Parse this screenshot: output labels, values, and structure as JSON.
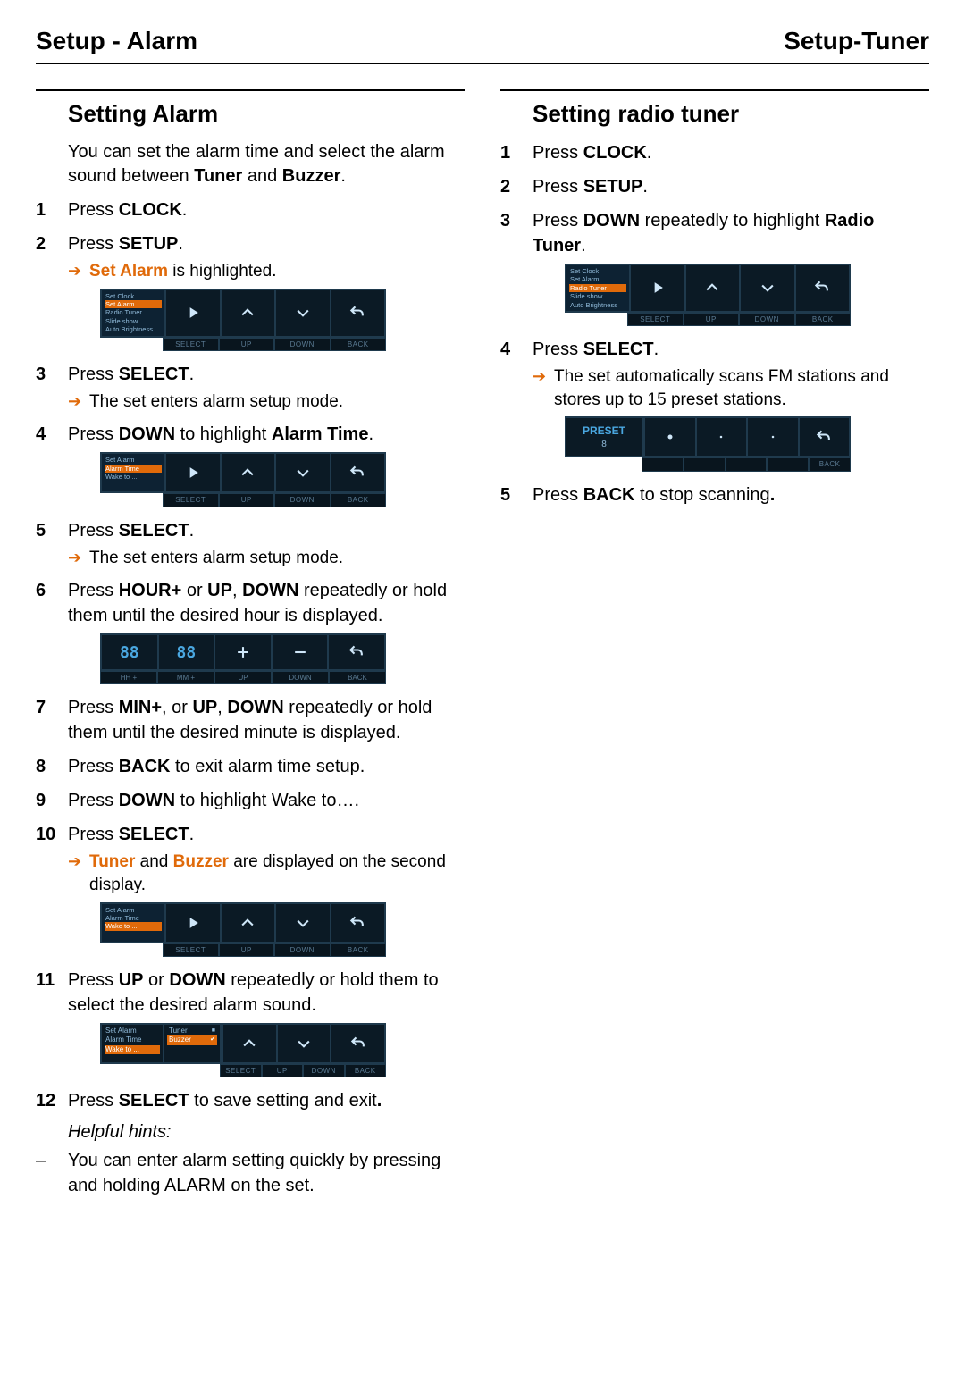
{
  "header": {
    "left": "Setup - Alarm",
    "right": "Setup-Tuner"
  },
  "left": {
    "title": "Setting Alarm",
    "intro_pre": "You can set the alarm time and select the alarm sound between ",
    "intro_b1": "Tuner",
    "intro_mid": " and ",
    "intro_b2": "Buzzer",
    "intro_post": ".",
    "step1_pre": "Press ",
    "step1_b": "CLOCK",
    "step1_post": ".",
    "step2_pre": "Press ",
    "step2_b": "SETUP",
    "step2_post": ".",
    "step2_sub_b": "Set Alarm",
    "step2_sub_post": " is highlighted.",
    "step3_pre": "Press ",
    "step3_b": "SELECT",
    "step3_post": ".",
    "step3_sub": "The set enters alarm setup mode.",
    "step4_pre": "Press ",
    "step4_b": "DOWN",
    "step4_mid": " to highlight ",
    "step4_b2": "Alarm Time",
    "step4_post": ".",
    "step5_pre": "Press ",
    "step5_b": "SELECT",
    "step5_post": ".",
    "step5_sub": "The set enters alarm setup mode.",
    "step6_pre": "Press ",
    "step6_b1": "HOUR+",
    "step6_mid1": " or ",
    "step6_b2": "UP",
    "step6_c": ", ",
    "step6_b3": "DOWN",
    "step6_post": " repeatedly or hold them until the desired hour is displayed.",
    "step7_pre": "Press ",
    "step7_b1": "MIN+",
    "step7_mid": ", or ",
    "step7_b2": "UP",
    "step7_c": ", ",
    "step7_b3": "DOWN",
    "step7_post": " repeatedly or hold them until the desired minute is displayed.",
    "step8_pre": "Press ",
    "step8_b": "BACK",
    "step8_post": " to exit alarm time setup.",
    "step9_pre": "Press ",
    "step9_b": "DOWN",
    "step9_post": " to highlight Wake to….",
    "step10_pre": "Press ",
    "step10_b": "SELECT",
    "step10_post": ".",
    "step10_sub_b1": "Tuner",
    "step10_sub_mid": " and ",
    "step10_sub_b2": "Buzzer",
    "step10_sub_post": " are displayed on the second display.",
    "step11_pre": "Press ",
    "step11_b1": "UP",
    "step11_mid": " or ",
    "step11_b2": "DOWN",
    "step11_post": " repeatedly or hold them to select the desired alarm sound.",
    "step12_pre": "Press ",
    "step12_b": "SELECT",
    "step12_post": " to save setting and exit",
    "step12_dot": ".",
    "hints_title": "Helpful hints:",
    "hint1": "You can enter alarm setting quickly by pressing and holding ALARM on the set."
  },
  "right": {
    "title": "Setting radio tuner",
    "step1_pre": "Press ",
    "step1_b": "CLOCK",
    "step1_post": ".",
    "step2_pre": "Press ",
    "step2_b": "SETUP",
    "step2_post": ".",
    "step3_pre": "Press ",
    "step3_b": "DOWN",
    "step3_mid": " repeatedly to highlight ",
    "step3_b2": "Radio Tuner",
    "step3_post": ".",
    "step4_pre": "Press ",
    "step4_b": "SELECT",
    "step4_post": ".",
    "step4_sub": "The set automatically scans FM stations and stores up to 15 preset stations.",
    "step5_pre": "Press ",
    "step5_b": "BACK",
    "step5_post": " to stop scanning",
    "step5_dot": "."
  },
  "screens": {
    "menuA": {
      "items": [
        "Set Clock",
        "Set Alarm",
        "Radio Tuner",
        "Slide show",
        "Auto Brightness"
      ],
      "hl": 1,
      "labels": [
        "SELECT",
        "UP",
        "DOWN",
        "BACK"
      ]
    },
    "menuB": {
      "items": [
        "Set Alarm",
        "Alarm Time",
        "Wake to ..."
      ],
      "hl": 1,
      "labels": [
        "SELECT",
        "UP",
        "DOWN",
        "BACK"
      ]
    },
    "time": {
      "hh": "88",
      "mm": "88",
      "labels": [
        "HH +",
        "MM +",
        "UP",
        "DOWN",
        "BACK"
      ]
    },
    "menuC": {
      "items": [
        "Set Alarm",
        "Alarm Time",
        "Wake to ..."
      ],
      "hl": 2,
      "labels": [
        "SELECT",
        "UP",
        "DOWN",
        "BACK"
      ]
    },
    "sel": {
      "left_items": [
        "Set Alarm",
        "Alarm Time",
        "Wake to ..."
      ],
      "left_hl": 2,
      "opts": [
        "Tuner",
        "Buzzer"
      ],
      "opt_hl": 1,
      "labels": [
        "SELECT",
        "UP",
        "DOWN",
        "BACK"
      ]
    },
    "menuT": {
      "items": [
        "Set Clock",
        "Set Alarm",
        "Radio Tuner",
        "Slide show",
        "Auto Brightness"
      ],
      "hl": 2,
      "labels": [
        "SELECT",
        "UP",
        "DOWN",
        "BACK"
      ]
    },
    "scan": {
      "preset": "PRESET",
      "num": "8",
      "labels": [
        "",
        "",
        "",
        "",
        "BACK"
      ]
    }
  }
}
